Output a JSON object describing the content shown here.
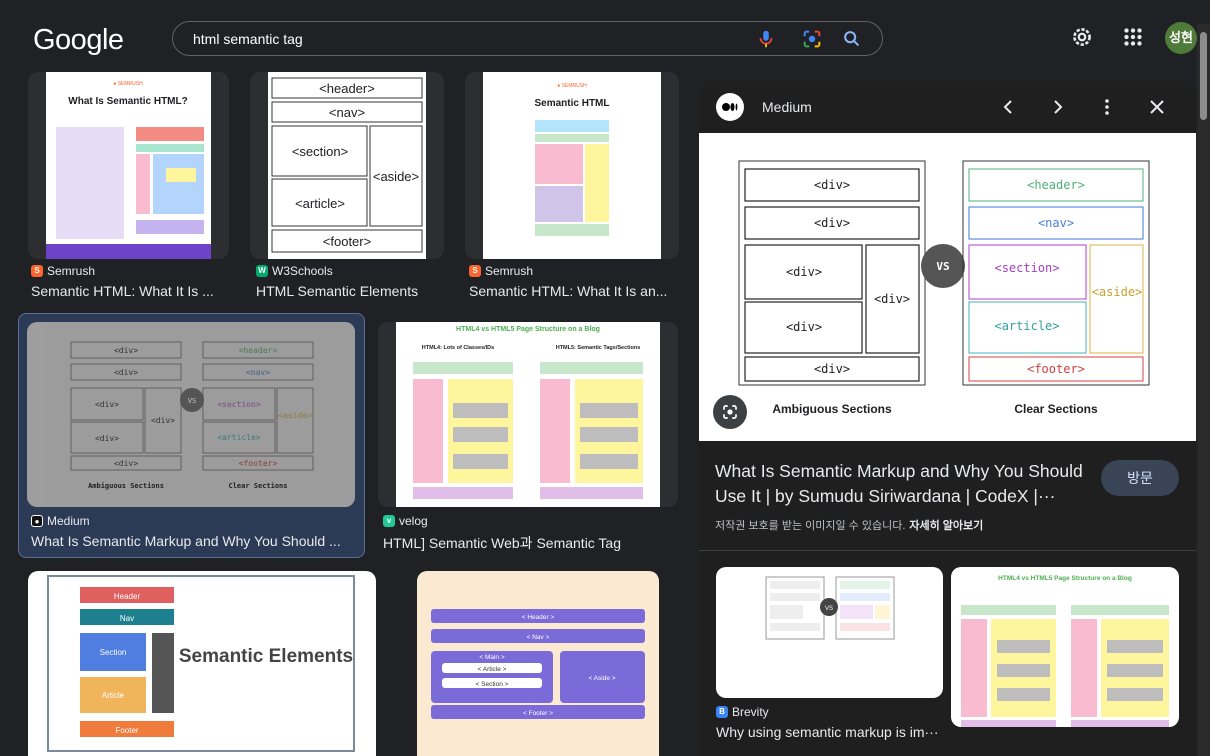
{
  "header": {
    "logo": "Google",
    "search_value": "html semantic tag",
    "avatar_text": "성현"
  },
  "results": [
    {
      "source": "Semrush",
      "title": "Semantic HTML: What It Is ...",
      "thumb_title": "What Is Semantic HTML?"
    },
    {
      "source": "W3Schools",
      "title": "HTML Semantic Elements"
    },
    {
      "source": "Semrush",
      "title": "Semantic HTML: What It Is an...",
      "thumb_title": "Semantic HTML"
    },
    {
      "source": "Medium",
      "title": "What Is Semantic Markup and Why You Should ..."
    },
    {
      "source": "velog",
      "title": "HTML] Semantic Web과 Semantic Tag",
      "thumb_title": "HTML4 vs HTML5 Page Structure on a Blog"
    },
    {
      "source": "",
      "title": "",
      "thumb_title": "Semantic Elements"
    },
    {
      "source": "",
      "title": ""
    }
  ],
  "w3": {
    "header": "<header>",
    "nav": "<nav>",
    "section": "<section>",
    "article": "<article>",
    "aside": "<aside>",
    "footer": "<footer>"
  },
  "diagram": {
    "left_caption": "Ambiguous Sections",
    "right_caption": "Clear Sections",
    "vs": "VS",
    "div": "<div>",
    "header": "<header>",
    "nav": "<nav>",
    "section": "<section>",
    "aside": "<aside>",
    "article": "<article>",
    "footer": "<footer>"
  },
  "panel": {
    "source": "Medium",
    "title": "What Is Semantic Markup and Why You Should Use It | by Sumudu Siriwardana | CodeX |···",
    "visit": "방문",
    "copyright": "저작권 보호를 받는 이미지일 수 있습니다.",
    "learn_more": "자세히 알아보기",
    "related": [
      {
        "source": "Brevity",
        "title": "Why using semantic markup is im···"
      },
      {
        "source": "",
        "title": "",
        "thumb_title": "HTML4 vs HTML5 Page Structure on a Blog"
      }
    ]
  },
  "colors": {
    "background": "#202124",
    "panel": "#1f1f1f",
    "selected": "#2b3a55",
    "semrush": "#ff642d",
    "w3schools": "#04aa6d",
    "velog": "#20c997"
  }
}
